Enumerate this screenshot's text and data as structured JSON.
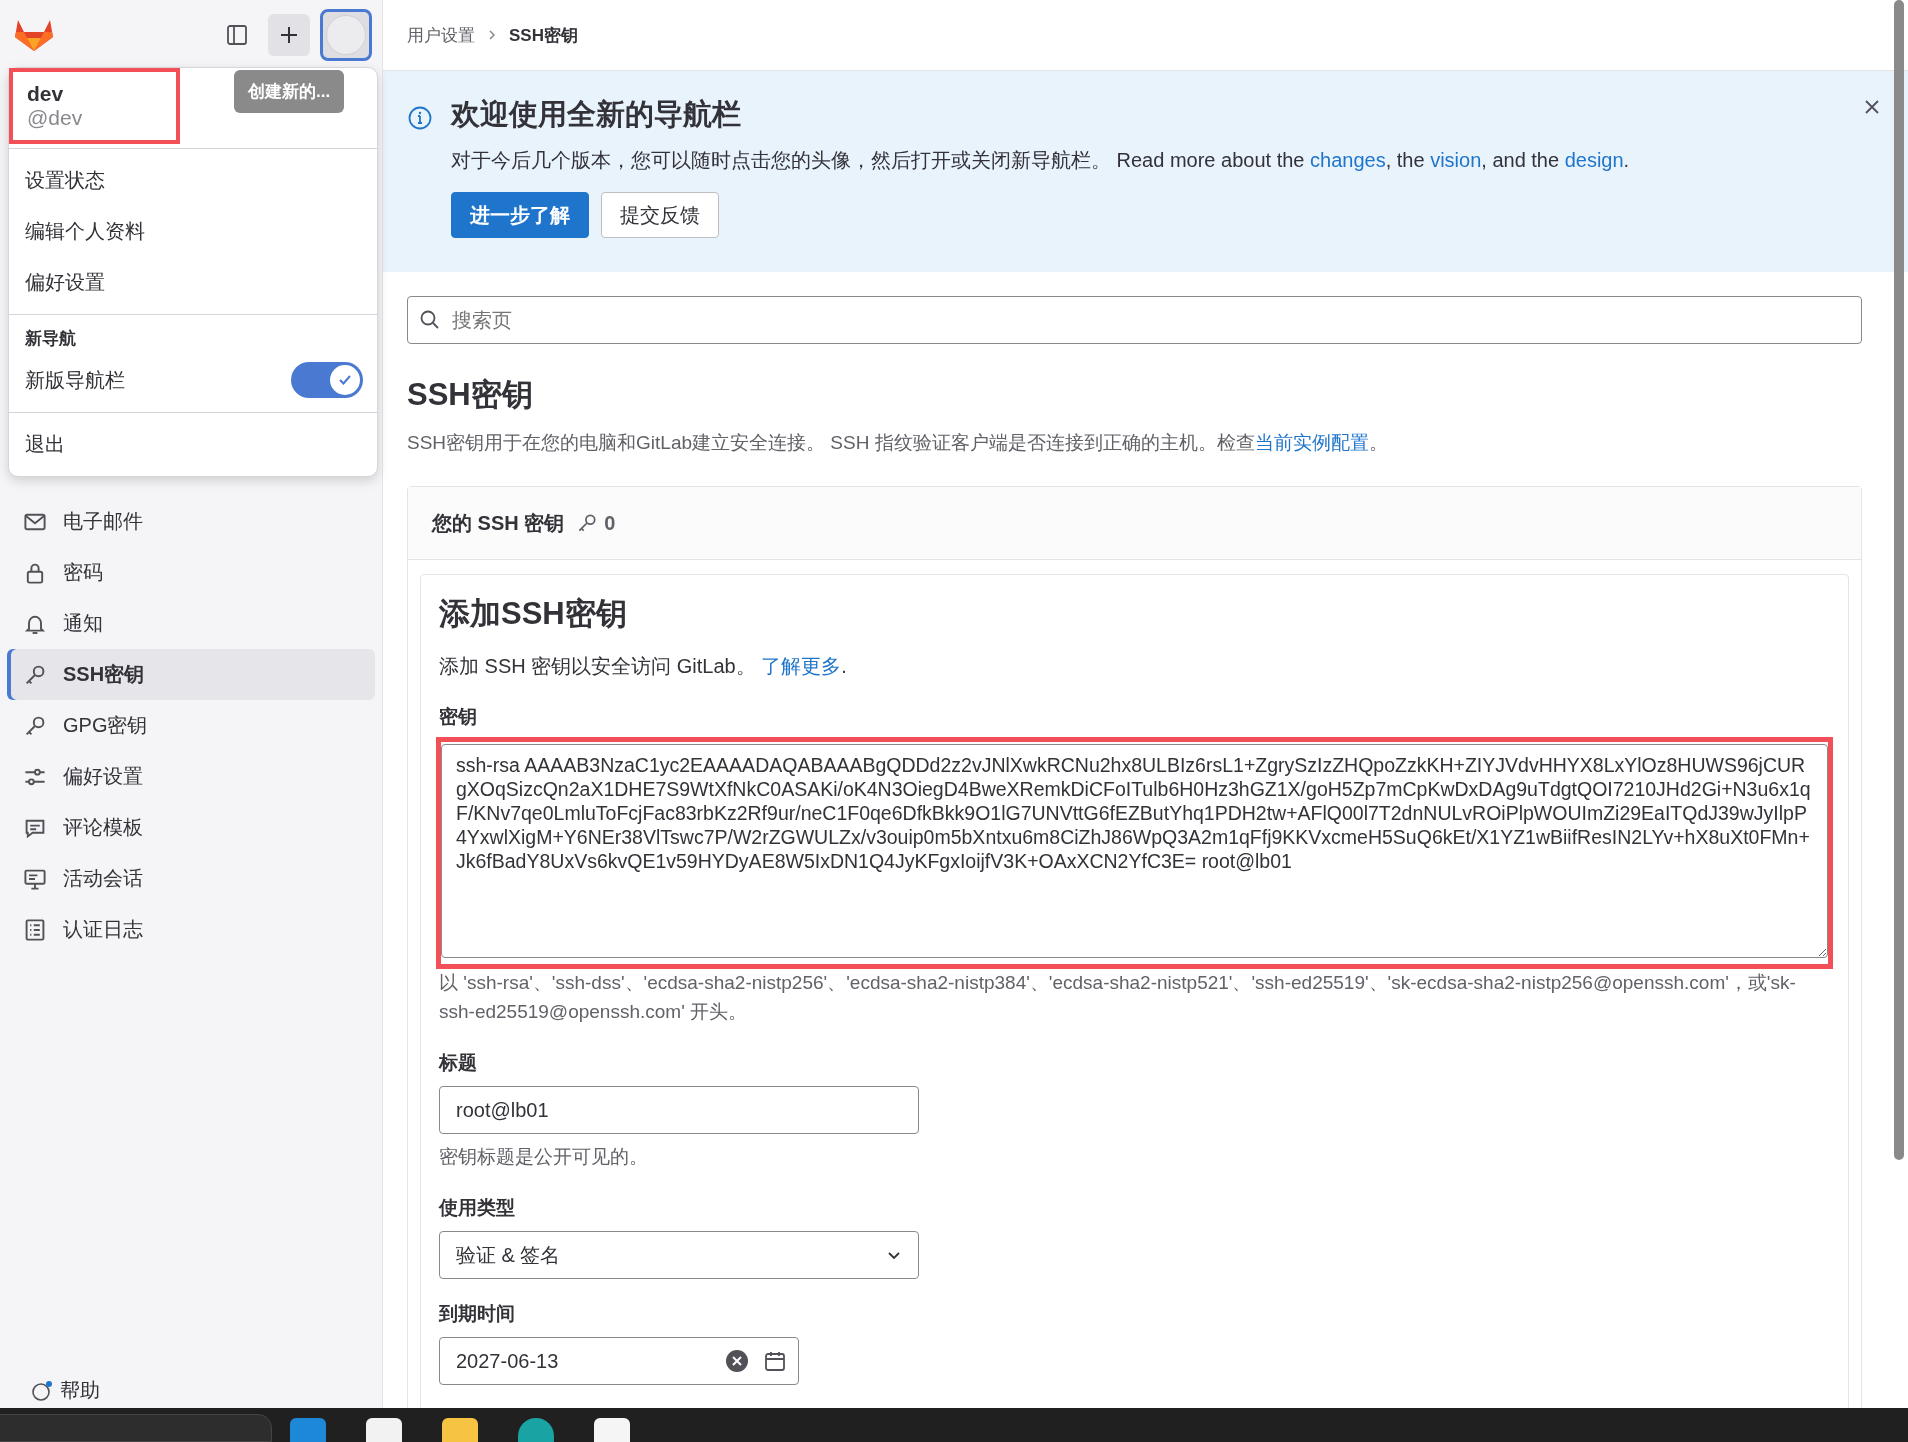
{
  "header": {
    "create_tooltip": "创建新的..."
  },
  "user_menu": {
    "name": "dev",
    "username": "@dev",
    "highlighted": true,
    "items": [
      "设置状态",
      "编辑个人资料",
      "偏好设置"
    ],
    "section_title": "新导航",
    "toggle": {
      "label": "新版导航栏",
      "on": true
    },
    "sign_out": "退出"
  },
  "sidebar": {
    "items": [
      {
        "label": "电子邮件",
        "selected": false
      },
      {
        "label": "密码",
        "selected": false
      },
      {
        "label": "通知",
        "selected": false
      },
      {
        "label": "SSH密钥",
        "selected": true
      },
      {
        "label": "GPG密钥",
        "selected": false
      },
      {
        "label": "偏好设置",
        "selected": false
      },
      {
        "label": "评论模板",
        "selected": false
      },
      {
        "label": "活动会话",
        "selected": false
      },
      {
        "label": "认证日志",
        "selected": false
      }
    ],
    "help": "帮助"
  },
  "breadcrumb": [
    "用户设置",
    "SSH密钥"
  ],
  "banner": {
    "title": "欢迎使用全新的导航栏",
    "body": [
      {
        "kind": "text",
        "text": "对于今后几个版本，您可以随时点击您的头像，然后打开或关闭新导航栏。 Read more about the "
      },
      {
        "kind": "link",
        "text": "changes"
      },
      {
        "kind": "text",
        "text": ", the "
      },
      {
        "kind": "link",
        "text": "vision"
      },
      {
        "kind": "text",
        "text": ", and the "
      },
      {
        "kind": "link",
        "text": "design"
      },
      {
        "kind": "text",
        "text": "."
      }
    ],
    "primary_button": "进一步了解",
    "secondary_button": "提交反馈"
  },
  "search": {
    "placeholder": "搜索页"
  },
  "page": {
    "title": "SSH密钥",
    "description": [
      {
        "kind": "text",
        "text": "SSH密钥用于在您的电脑和GitLab建立安全连接。 SSH 指纹验证客户端是否连接到正确的主机。检查"
      },
      {
        "kind": "link",
        "text": "当前实例配置"
      },
      {
        "kind": "text",
        "text": "。"
      }
    ]
  },
  "keys_card": {
    "title": "您的 SSH 密钥",
    "count": "0"
  },
  "add_form": {
    "title": "添加SSH密钥",
    "description": [
      {
        "kind": "text",
        "text": "添加 SSH 密钥以安全访问 GitLab。 "
      },
      {
        "kind": "link",
        "text": "了解更多"
      },
      {
        "kind": "text",
        "text": "."
      }
    ],
    "key_field": {
      "label": "密钥",
      "highlighted": true,
      "value": "ssh-rsa AAAAB3NzaC1yc2EAAAADAQABAAABgQDDd2z2vJNlXwkRCNu2hx8ULBIz6rsL1+ZgrySzIzZHQpoZzkKH+ZIYJVdvHHYX8LxYlOz8HUWS96jCURgXOqSizcQn2aX1DHE7S9WtXfNkC0ASAKi/oK4N3OiegD4BweXRemkDiCFoITulb6H0Hz3hGZ1X/goH5Zp7mCpKwDxDAg9uTdgtQOI7210JHd2Gi+N3u6x1qF/KNv7qe0LmluToFcjFac83rbKz2Rf9ur/neC1F0qe6DfkBkk9O1lG7UNVttG6fEZButYhq1PDH2tw+AFlQ00l7T2dnNULvROiPlpWOUImZi29EaITQdJ39wJyIlpP4YxwlXigM+Y6NEr38VlTswc7P/W2rZGWULZx/v3ouip0m5bXntxu6m8CiZhJ86WpQ3A2m1qFfj9KKVxcmeH5SuQ6kEt/X1YZ1wBiifResIN2LYv+hX8uXt0FMn+Jk6fBadY8UxVs6kvQE1v59HYDyAE8W5IxDN1Q4JyKFgxIoijfV3K+OAxXCN2YfC3E= root@lb01",
      "hint": "以 'ssh-rsa'、'ssh-dss'、'ecdsa-sha2-nistp256'、'ecdsa-sha2-nistp384'、'ecdsa-sha2-nistp521'、'ssh-ed25519'、'sk-ecdsa-sha2-nistp256@openssh.com'，或'sk-ssh-ed25519@openssh.com' 开头。"
    },
    "title_field": {
      "label": "标题",
      "value": "root@lb01",
      "hint": "密钥标题是公开可见的。"
    },
    "usage_field": {
      "label": "使用类型",
      "value": "验证 & 签名"
    },
    "expiry_field": {
      "label": "到期时间",
      "value": "2027-06-13"
    }
  }
}
